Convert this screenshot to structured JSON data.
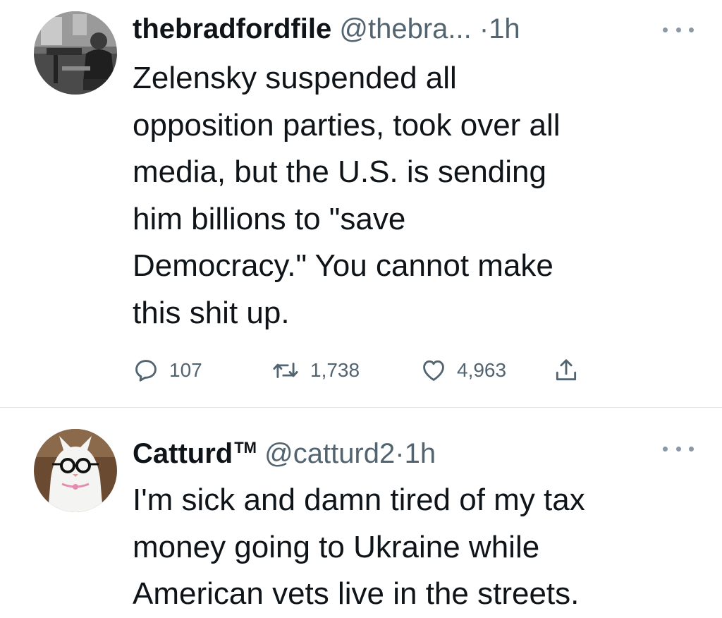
{
  "tweets": [
    {
      "display_name": "thebradfordfile",
      "handle": "@thebra...",
      "separator": "·",
      "time": "1h",
      "text_lines": [
        "Zelensky suspended all",
        "opposition parties, took over all",
        "media, but the U.S. is sending",
        "him billions to \"save",
        "Democracy.\" You cannot make",
        "this shit up."
      ],
      "actions": {
        "reply_count": "107",
        "retweet_count": "1,738",
        "like_count": "4,963"
      },
      "icons": {
        "more": "more-horizontal-icon",
        "reply": "reply-bubble-icon",
        "retweet": "retweet-icon",
        "like": "heart-icon",
        "share": "share-icon"
      }
    },
    {
      "display_name": "Catturd",
      "name_badge": "TM",
      "handle": "@catturd2",
      "separator": "·",
      "time": "1h",
      "text_lines": [
        "I'm sick and damn tired of my tax",
        "money going to Ukraine while",
        "American vets live in the streets."
      ],
      "icons": {
        "more": "more-horizontal-icon"
      }
    }
  ],
  "colors": {
    "text": "#0f1419",
    "secondary": "#536471",
    "divider": "#e3e6e8"
  }
}
